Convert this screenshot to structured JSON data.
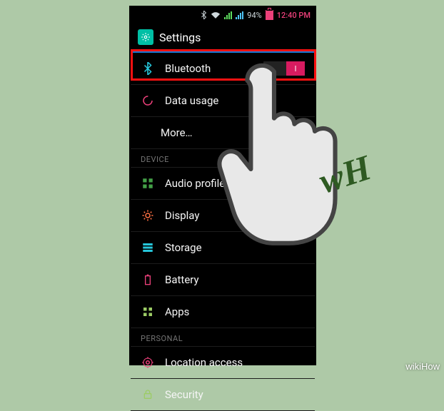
{
  "status": {
    "battery_pct": "94%",
    "time": "12:40 PM"
  },
  "app_title": "Settings",
  "items": {
    "bluetooth": "Bluetooth",
    "bluetooth_toggle": "I",
    "data_usage": "Data usage",
    "more": "More…",
    "audio_profiles": "Audio profiles",
    "display": "Display",
    "storage": "Storage",
    "battery": "Battery",
    "apps": "Apps",
    "location_access": "Location access",
    "security": "Security"
  },
  "headers": {
    "device": "DEVICE",
    "personal": "PERSONAL"
  },
  "hand_label": "wH",
  "watermark": "wikiHow"
}
